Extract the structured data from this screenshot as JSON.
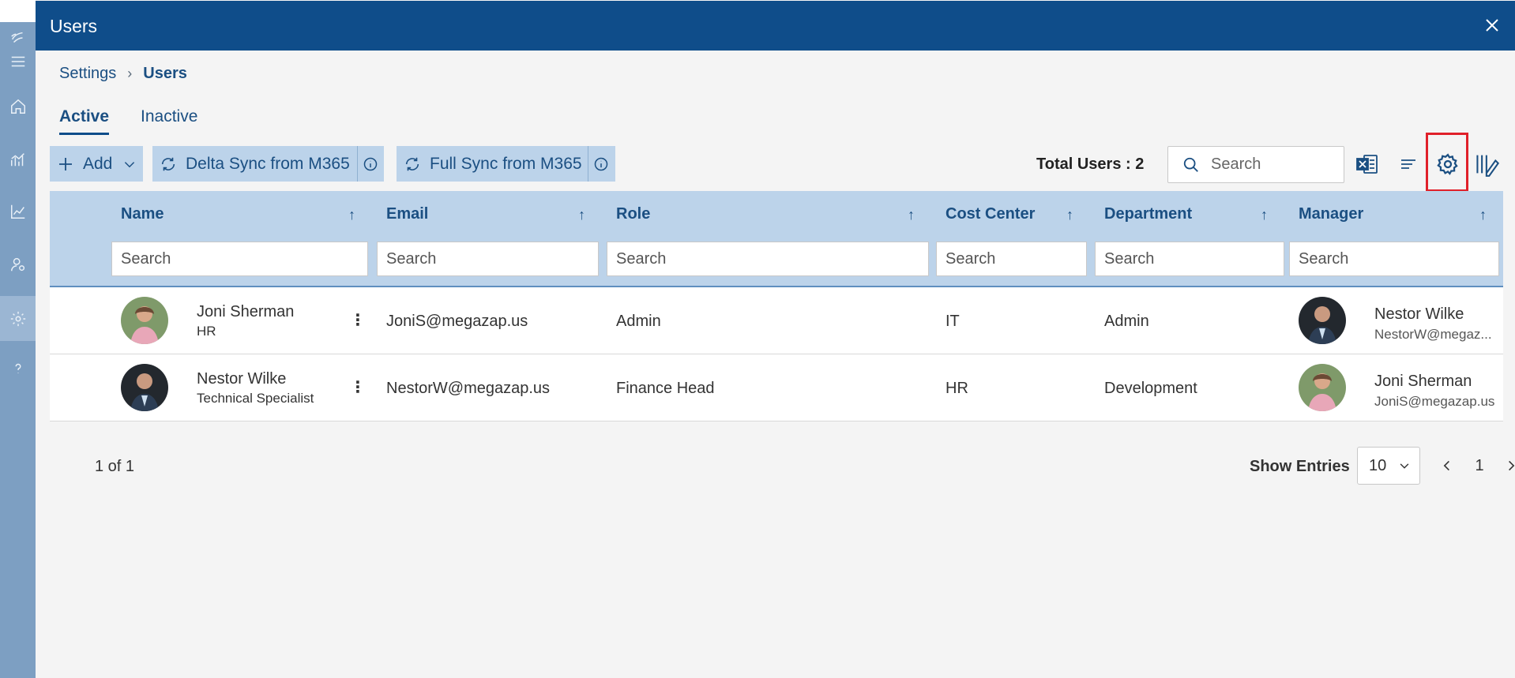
{
  "window": {
    "title": "Users"
  },
  "breadcrumb": {
    "parent": "Settings",
    "current": "Users"
  },
  "tabs": [
    {
      "label": "Active"
    },
    {
      "label": "Inactive"
    }
  ],
  "toolbar": {
    "add_label": "Add",
    "delta_sync_label": "Delta Sync from M365",
    "full_sync_label": "Full Sync from M365",
    "total_label": "Total Users : 2",
    "search_placeholder": "Search"
  },
  "columns": [
    {
      "label": "Name",
      "filter_placeholder": "Search"
    },
    {
      "label": "Email",
      "filter_placeholder": "Search"
    },
    {
      "label": "Role",
      "filter_placeholder": "Search"
    },
    {
      "label": "Cost Center",
      "filter_placeholder": "Search"
    },
    {
      "label": "Department",
      "filter_placeholder": "Search"
    },
    {
      "label": "Manager",
      "filter_placeholder": "Search"
    }
  ],
  "rows": [
    {
      "name": "Joni Sherman",
      "title": "HR",
      "email": "JoniS@megazap.us",
      "role": "Admin",
      "cost_center": "IT",
      "department": "Admin",
      "manager_name": "Nestor Wilke",
      "manager_email": "NestorW@megaz..."
    },
    {
      "name": "Nestor Wilke",
      "title": "Technical Specialist",
      "email": "NestorW@megazap.us",
      "role": "Finance Head",
      "cost_center": "HR",
      "department": "Development",
      "manager_name": "Joni Sherman",
      "manager_email": "JoniS@megazap.us"
    }
  ],
  "pager": {
    "page_info": "1 of 1",
    "show_entries_label": "Show Entries",
    "page_size": "10",
    "current_page": "1"
  },
  "colors": {
    "header": "#0f4d8a",
    "accent": "#bcd3ea",
    "highlight": "#e0202a"
  }
}
